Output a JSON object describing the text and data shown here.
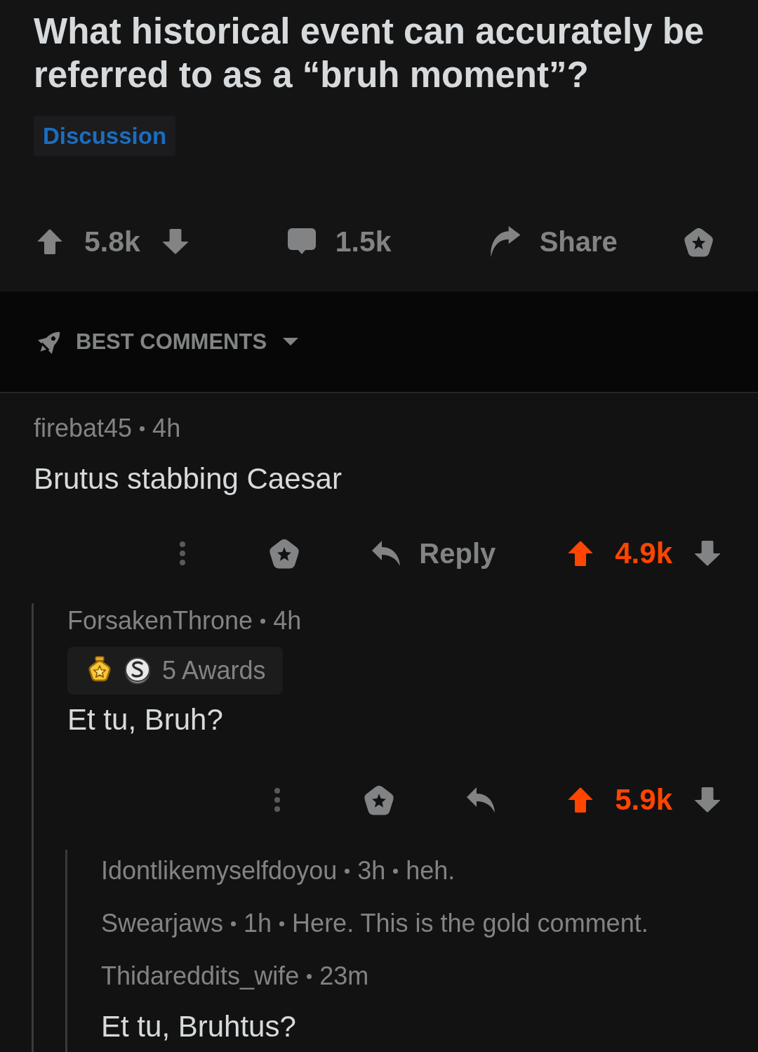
{
  "post": {
    "title": "What historical event can accurately be referred to as a “bruh moment”?",
    "flair": "Discussion",
    "score": "5.8k",
    "upvoted": false,
    "comment_count": "1.5k",
    "share_label": "Share"
  },
  "sort": {
    "label": "BEST COMMENTS"
  },
  "comments": [
    {
      "author": "firebat45",
      "age": "4h",
      "body": "Brutus stabbing Caesar",
      "reply_label": "Reply",
      "score": "4.9k",
      "upvoted": true,
      "children": [
        {
          "author": "ForsakenThrone",
          "age": "4h",
          "awards": {
            "label": "5 Awards"
          },
          "body": "Et tu, Bruh?",
          "score": "5.9k",
          "upvoted": true,
          "children": [
            {
              "author": "Idontlikemyselfdoyou",
              "age": "3h",
              "preview": "heh.",
              "collapsed": true
            },
            {
              "author": "Swearjaws",
              "age": "1h",
              "preview": "Here. This is the gold comment.",
              "collapsed": true
            },
            {
              "author": "Thidareddits_wife",
              "age": "23m",
              "body": "Et tu, Bruhtus?",
              "collapsed": false
            }
          ]
        }
      ]
    }
  ]
}
